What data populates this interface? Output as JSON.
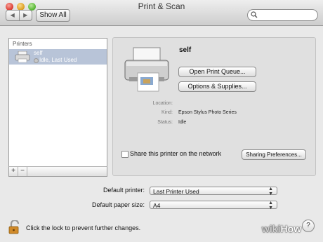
{
  "window": {
    "title": "Print & Scan",
    "back_glyph": "◀",
    "forward_glyph": "▶",
    "show_all_label": "Show All",
    "search_placeholder": ""
  },
  "printers_list": {
    "header": "Printers",
    "items": [
      {
        "name": "self",
        "status": "Idle, Last Used",
        "icon": "printer-icon",
        "selected": true
      }
    ],
    "add_label": "+",
    "remove_label": "−"
  },
  "detail": {
    "printer_name": "self",
    "open_queue_label": "Open Print Queue...",
    "options_label": "Options & Supplies...",
    "location_label": "Location:",
    "location_value": "",
    "kind_label": "Kind:",
    "kind_value": "Epson Stylus Photo Series",
    "status_label": "Status:",
    "status_value": "Idle",
    "share_label": "Share this printer on the network",
    "share_checked": false,
    "sharing_prefs_label": "Sharing Preferences..."
  },
  "defaults": {
    "default_printer_label": "Default printer:",
    "default_printer_value": "Last Printer Used",
    "paper_size_label": "Default paper size:",
    "paper_size_value": "A4"
  },
  "footer": {
    "lock_text": "Click the lock to prevent further changes.",
    "help_label": "?",
    "watermark_wiki": "wiki",
    "watermark_how": "How"
  },
  "colors": {
    "selection": "#b8c4d8",
    "window_bg": "#e9e9e9",
    "panel_bg": "#e0e0e0"
  }
}
